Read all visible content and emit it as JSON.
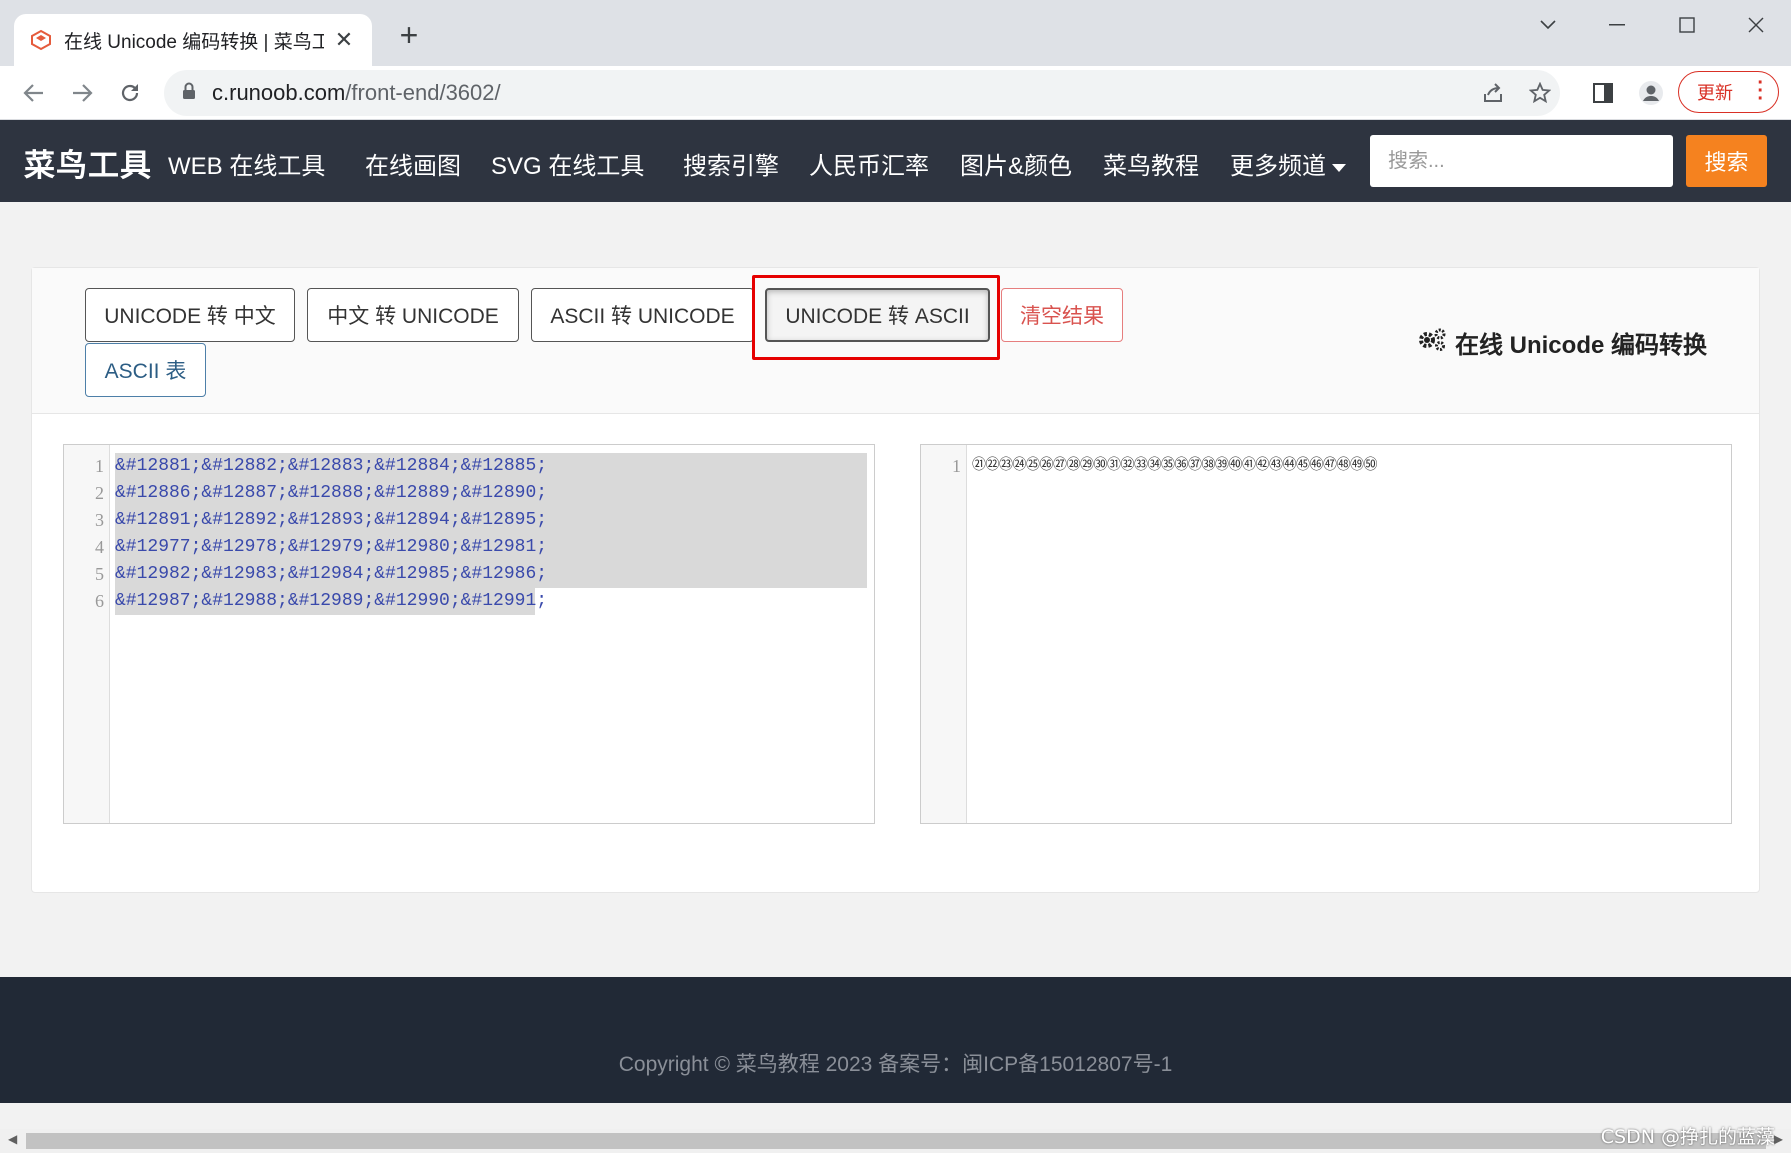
{
  "browser": {
    "tab_title": "在线 Unicode 编码转换 | 菜鸟工",
    "tab_close": "✕",
    "new_tab": "+",
    "url_host": "c.runoob.com",
    "url_path": "/front-end/3602/",
    "update_label": "更新",
    "icons": [
      "back-arrow-icon",
      "forward-arrow-icon",
      "reload-icon",
      "lock-icon",
      "share-icon",
      "star-icon",
      "sidebar-icon",
      "profile-icon",
      "menu-dots-icon"
    ]
  },
  "site": {
    "brand": "菜鸟工具",
    "nav": [
      "WEB 在线工具",
      "在线画图",
      "SVG 在线工具",
      "搜索引擎",
      "人民币汇率",
      "图片&颜色",
      "菜鸟教程",
      "更多频道"
    ],
    "search_placeholder": "搜索...",
    "search_button": "搜索",
    "accent_color": "#f5821f"
  },
  "tool": {
    "title": "在线 Unicode 编码转换",
    "buttons": {
      "unicode_to_cn": "UNICODE 转 中文",
      "cn_to_unicode": "中文 转 UNICODE",
      "ascii_to_unicode": "ASCII 转 UNICODE",
      "unicode_to_ascii": "UNICODE 转 ASCII",
      "clear": "清空结果",
      "ascii_table": "ASCII 表"
    },
    "active_button": "UNICODE 转 ASCII",
    "input": {
      "line_numbers": [
        "1",
        "2",
        "3",
        "4",
        "5",
        "6"
      ],
      "lines": [
        "&#12881;&#12882;&#12883;&#12884;&#12885;",
        "&#12886;&#12887;&#12888;&#12889;&#12890;",
        "&#12891;&#12892;&#12893;&#12894;&#12895;",
        "&#12977;&#12978;&#12979;&#12980;&#12981;",
        "&#12982;&#12983;&#12984;&#12985;&#12986;",
        "&#12987;&#12988;&#12989;&#12990;&#12991;"
      ]
    },
    "output": {
      "line_numbers": [
        "1"
      ],
      "lines": [
        "㉑㉒㉓㉔㉕㉖㉗㉘㉙㉚㉛㉜㉝㉞㉟㊱㊲㊳㊴㊵㊶㊷㊸㊹㊺㊻㊼㊽㊾㊿"
      ]
    }
  },
  "footer": {
    "copyright": "Copyright © 菜鸟教程 2023 备案号：闽ICP备15012807号-1"
  },
  "watermark": "CSDN @挣扎的蓝藻"
}
